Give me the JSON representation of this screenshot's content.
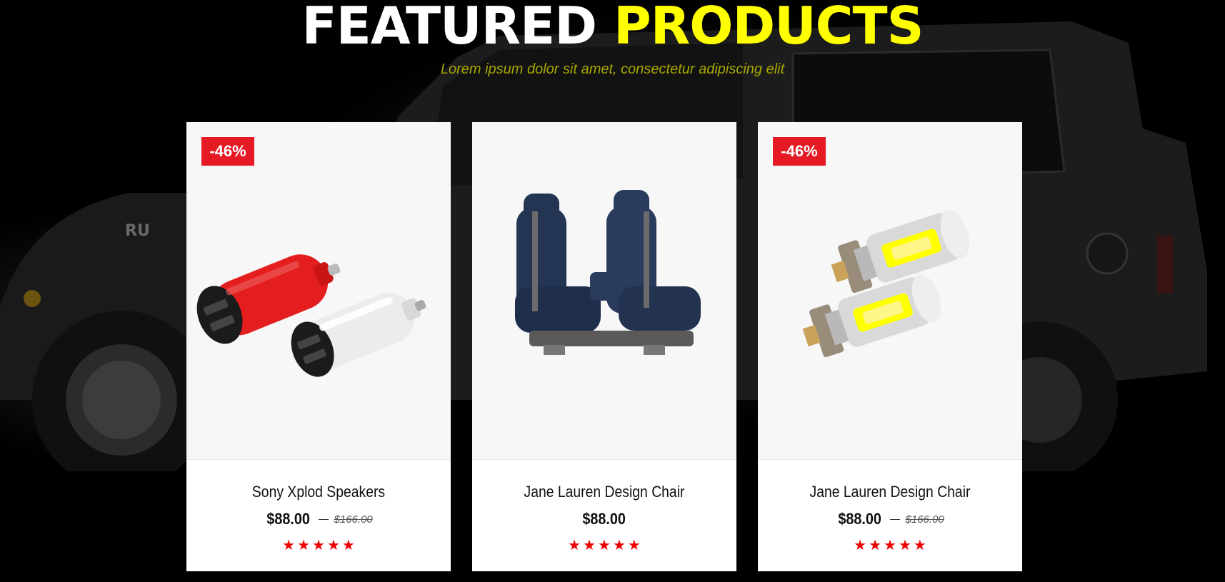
{
  "section": {
    "title_part1": "FEATURED",
    "title_part2": "PRODUCTS",
    "subtitle": "Lorem ipsum dolor sit amet, consectetur adipiscing elit"
  },
  "colors": {
    "title_accent": "#ffff00",
    "badge": "#e51a25",
    "stars": "#ee0000"
  },
  "products": [
    {
      "badge": "-46%",
      "image_icon": "car-charger-image",
      "name": "Sony Xplod Speakers",
      "price": "$88.00",
      "old_price": "$166.00",
      "rating_stars": 5
    },
    {
      "badge": "",
      "image_icon": "car-seat-image",
      "name": "Jane Lauren Design Chair",
      "price": "$88.00",
      "old_price": "",
      "rating_stars": 5
    },
    {
      "badge": "-46%",
      "image_icon": "led-bulb-image",
      "name": "Jane Lauren Design Chair",
      "price": "$88.00",
      "old_price": "$166.00",
      "rating_stars": 5
    }
  ]
}
